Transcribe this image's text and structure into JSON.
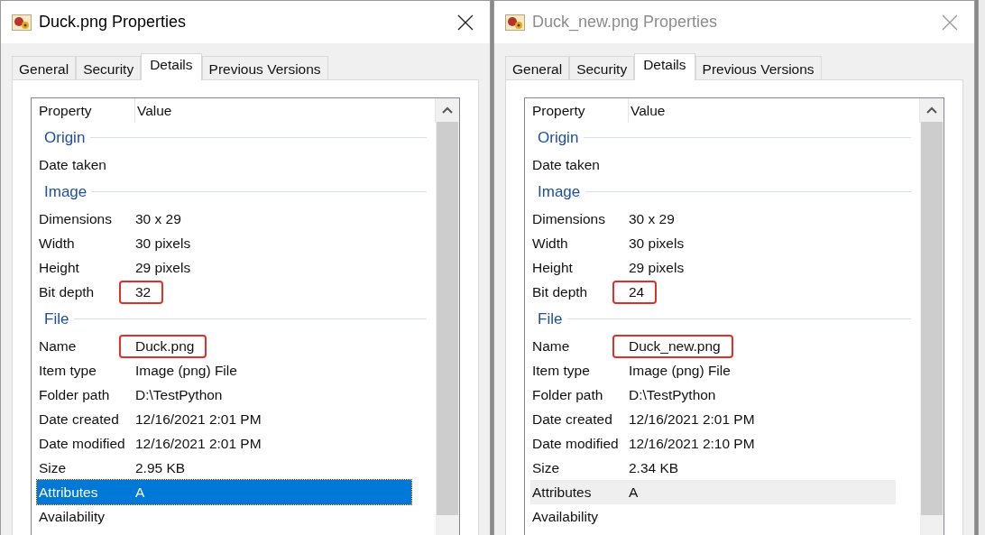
{
  "dialogs": [
    {
      "title": "Duck.png Properties",
      "active": true,
      "tabs": [
        {
          "label": "General",
          "selected": false
        },
        {
          "label": "Security",
          "selected": false
        },
        {
          "label": "Details",
          "selected": true
        },
        {
          "label": "Previous Versions",
          "selected": false
        }
      ],
      "columns": [
        "Property",
        "Value"
      ],
      "rows": [
        {
          "kind": "group",
          "label": "Origin"
        },
        {
          "kind": "item",
          "property": "Date taken",
          "selected": false
        },
        {
          "kind": "group",
          "label": "Image"
        },
        {
          "kind": "item",
          "property": "Dimensions",
          "value": "30 x 29",
          "selected": false,
          "highlighted": false
        },
        {
          "kind": "item",
          "property": "Width",
          "value": "30 pixels",
          "selected": false,
          "highlighted": false
        },
        {
          "kind": "item",
          "property": "Height",
          "value": "29 pixels",
          "selected": false,
          "highlighted": false
        },
        {
          "kind": "item",
          "property": "Bit depth",
          "value": "32",
          "selected": false,
          "highlighted": true
        },
        {
          "kind": "group",
          "label": "File"
        },
        {
          "kind": "item",
          "property": "Name",
          "value": "Duck.png",
          "selected": false,
          "highlighted": true
        },
        {
          "kind": "item",
          "property": "Item type",
          "value": "Image (png) File",
          "selected": false,
          "highlighted": false
        },
        {
          "kind": "item",
          "property": "Folder path",
          "value": "D:\\TestPython",
          "selected": false,
          "highlighted": false
        },
        {
          "kind": "item",
          "property": "Date created",
          "value": "12/16/2021 2:01 PM",
          "selected": false,
          "highlighted": false
        },
        {
          "kind": "item",
          "property": "Date modified",
          "value": "12/16/2021 2:01 PM",
          "selected": false,
          "highlighted": false
        },
        {
          "kind": "item",
          "property": "Size",
          "value": "2.95 KB",
          "selected": false,
          "highlighted": false
        },
        {
          "kind": "item",
          "property": "Attributes",
          "value": "A",
          "selected": true,
          "highlighted": false
        },
        {
          "kind": "item",
          "property": "Availability",
          "selected": false
        }
      ]
    },
    {
      "title": "Duck_new.png Properties",
      "active": false,
      "tabs": [
        {
          "label": "General",
          "selected": false
        },
        {
          "label": "Security",
          "selected": false
        },
        {
          "label": "Details",
          "selected": true
        },
        {
          "label": "Previous Versions",
          "selected": false
        }
      ],
      "columns": [
        "Property",
        "Value"
      ],
      "rows": [
        {
          "kind": "group",
          "label": "Origin"
        },
        {
          "kind": "item",
          "property": "Date taken",
          "selected": false
        },
        {
          "kind": "group",
          "label": "Image"
        },
        {
          "kind": "item",
          "property": "Dimensions",
          "value": "30 x 29",
          "selected": false,
          "highlighted": false
        },
        {
          "kind": "item",
          "property": "Width",
          "value": "30 pixels",
          "selected": false,
          "highlighted": false
        },
        {
          "kind": "item",
          "property": "Height",
          "value": "29 pixels",
          "selected": false,
          "highlighted": false
        },
        {
          "kind": "item",
          "property": "Bit depth",
          "value": "24",
          "selected": false,
          "highlighted": true
        },
        {
          "kind": "group",
          "label": "File"
        },
        {
          "kind": "item",
          "property": "Name",
          "value": "Duck_new.png",
          "selected": false,
          "highlighted": true
        },
        {
          "kind": "item",
          "property": "Item type",
          "value": "Image (png) File",
          "selected": false,
          "highlighted": false
        },
        {
          "kind": "item",
          "property": "Folder path",
          "value": "D:\\TestPython",
          "selected": false,
          "highlighted": false
        },
        {
          "kind": "item",
          "property": "Date created",
          "value": "12/16/2021 2:01 PM",
          "selected": false,
          "highlighted": false
        },
        {
          "kind": "item",
          "property": "Date modified",
          "value": "12/16/2021 2:10 PM",
          "selected": false,
          "highlighted": false
        },
        {
          "kind": "item",
          "property": "Size",
          "value": "2.34 KB",
          "selected": false,
          "highlighted": false
        },
        {
          "kind": "item",
          "property": "Attributes",
          "value": "A",
          "selected": true,
          "highlighted": false
        },
        {
          "kind": "item",
          "property": "Availability",
          "selected": false
        }
      ]
    }
  ]
}
